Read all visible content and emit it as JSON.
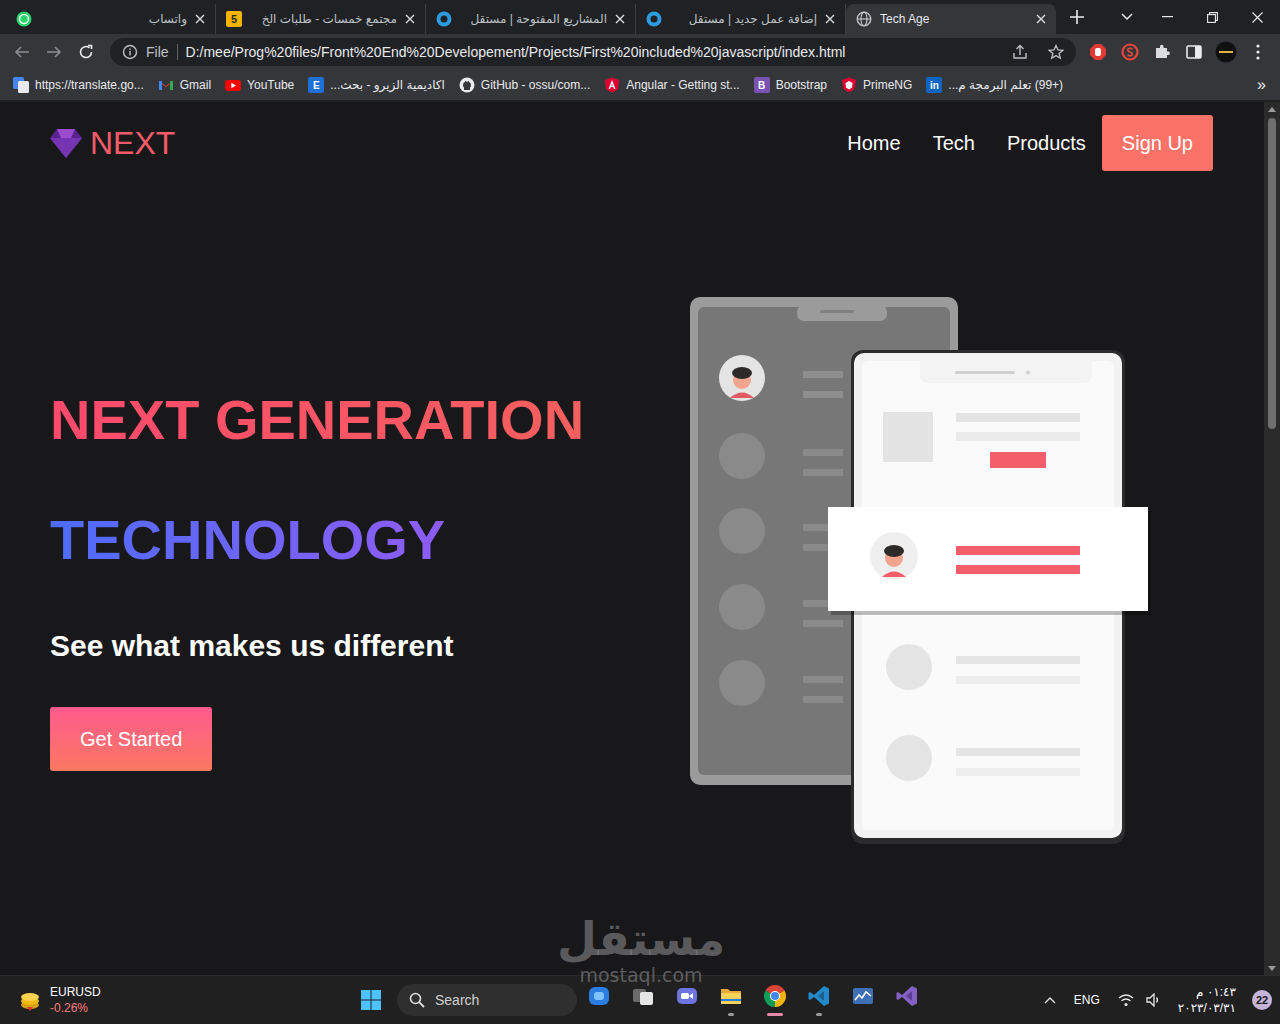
{
  "tabs": [
    {
      "label": "واتساب",
      "kind": "whatsapp",
      "selected": false
    },
    {
      "label": "مجتمع خمسات - طلبات الخ",
      "kind": "khamsat",
      "icon_text": "5",
      "selected": false
    },
    {
      "label": "المشاريع المفتوحة | مستقل",
      "kind": "mostaql",
      "selected": false
    },
    {
      "label": "إضافة عمل جديد | مستقل",
      "kind": "mostaql",
      "selected": false
    },
    {
      "label": "Tech Age",
      "kind": "globe",
      "selected": true
    }
  ],
  "address_bar": {
    "scheme": "File",
    "url": "D:/mee/Prog%20files/Front%20End%20Developement/Projects/First%20included%20javascript/index.html"
  },
  "bookmarks": {
    "items": [
      {
        "label": "https://translate.go...",
        "kind": "translate"
      },
      {
        "label": "Gmail",
        "kind": "gmail"
      },
      {
        "label": "YouTube",
        "kind": "youtube"
      },
      {
        "label": "اكاديمية الزيرو - بحث...",
        "kind": "letter",
        "icon_text": "E",
        "color": "#1e6fd6"
      },
      {
        "label": "GitHub - ossu/com...",
        "kind": "github"
      },
      {
        "label": "Angular - Getting st...",
        "kind": "angular"
      },
      {
        "label": "Bootstrap",
        "kind": "letter",
        "icon_text": "B",
        "color": "#7952b3"
      },
      {
        "label": "PrimeNG",
        "kind": "primeng"
      },
      {
        "label": "(+99) تعلم البرمجة م...",
        "kind": "letter",
        "icon_text": "in",
        "color": "#0a66c2"
      }
    ],
    "overflow": "»"
  },
  "page": {
    "logo": "NEXT",
    "nav": [
      "Home",
      "Tech",
      "Products"
    ],
    "cta": "Sign Up",
    "headline": [
      "NEXT GENERATION",
      "TECHNOLOGY"
    ],
    "subtitle": "See what makes us different",
    "button": "Get Started"
  },
  "scrollbar": {
    "level": 0.37
  },
  "watermark": {
    "title": "مستقل",
    "url": "mostaql.com"
  },
  "taskbar": {
    "widget": {
      "symbol": "EURUSD",
      "change": "-0.26%"
    },
    "search": "Search",
    "apps": [
      {
        "kind": "copilot",
        "running": false,
        "active": false
      },
      {
        "kind": "taskview",
        "running": false,
        "active": false
      },
      {
        "kind": "chat",
        "running": false,
        "active": false
      },
      {
        "kind": "explorer",
        "running": true,
        "active": false
      },
      {
        "kind": "chrome",
        "running": true,
        "active": true
      },
      {
        "kind": "vscode",
        "running": true,
        "active": false
      },
      {
        "kind": "monitor",
        "running": false,
        "active": false
      },
      {
        "kind": "visualstudio",
        "running": false,
        "active": false
      }
    ],
    "language": "ENG",
    "time": "٠١:٤٣ م",
    "date": "٢٠٢٣/٠٣/٣١",
    "notifications": "22"
  }
}
